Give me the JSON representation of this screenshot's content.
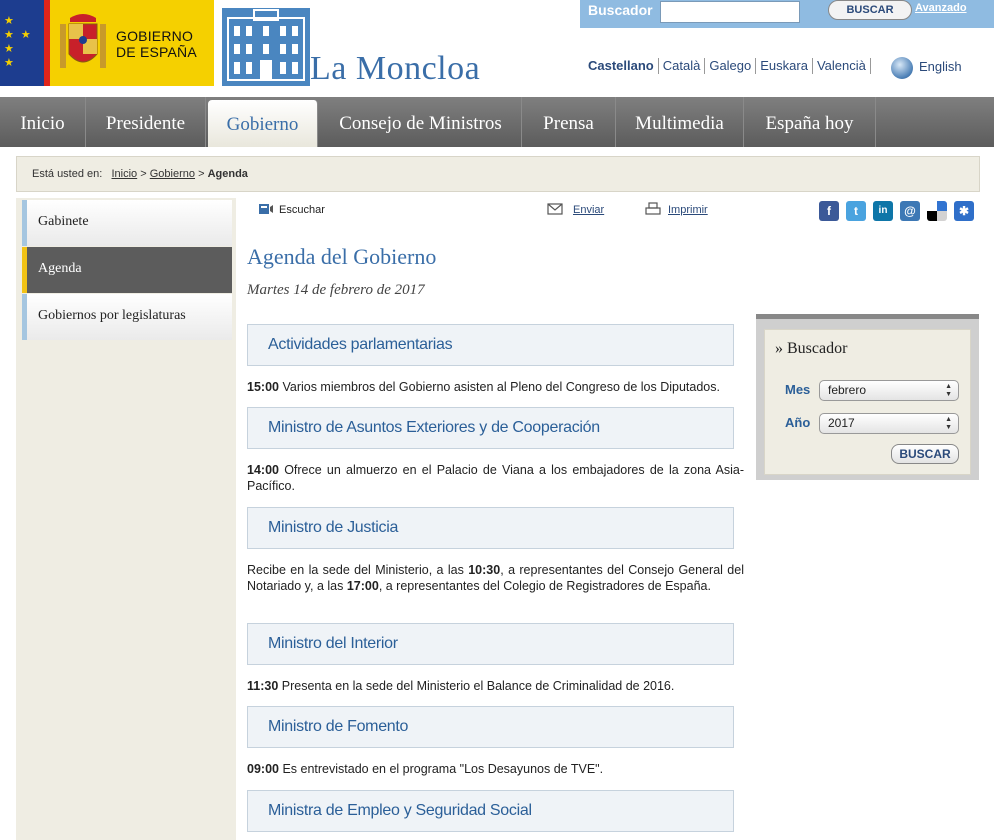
{
  "header": {
    "gov_title_line1": "GOBIERNO",
    "gov_title_line2": "DE ESPAÑA",
    "site_title": "La Moncloa",
    "search_label": "Buscador",
    "search_value": "",
    "search_button": "BUSCAR",
    "advanced_link": "Avanzado",
    "languages": [
      "Castellano",
      "Català",
      "Galego",
      "Euskara",
      "Valencià"
    ],
    "selected_language": "Castellano",
    "english": "English"
  },
  "nav": {
    "items": [
      "Inicio",
      "Presidente",
      "Gobierno",
      "Consejo de Ministros",
      "Prensa",
      "Multimedia",
      "España hoy"
    ],
    "active": "Gobierno"
  },
  "breadcrumb": {
    "prefix": "Está usted en:",
    "items": [
      "Inicio",
      "Gobierno"
    ],
    "current": "Agenda",
    "sep": ">"
  },
  "sidebar": {
    "items": [
      {
        "label": "Gabinete"
      },
      {
        "label": "Agenda"
      },
      {
        "label": "Gobiernos por legislaturas"
      }
    ],
    "active": "Agenda"
  },
  "tools": {
    "listen": "Escuchar",
    "send": "Enviar",
    "print": "Imprimir"
  },
  "main": {
    "title": "Agenda del Gobierno",
    "date": "Martes 14 de febrero de 2017",
    "sections": [
      {
        "title": "Actividades parlamentarias"
      },
      {
        "title": "Ministro de Asuntos Exteriores y de Cooperación"
      },
      {
        "title": "Ministro de Justicia"
      },
      {
        "title": "Ministro del Interior"
      },
      {
        "title": "Ministro de Fomento"
      },
      {
        "title": "Ministra de Empleo y Seguridad Social"
      }
    ],
    "entries": {
      "e1_time": "15:00",
      "e1_text": " Varios miembros del Gobierno asisten al Pleno del Congreso de los Diputados.",
      "e2_time": "14:00",
      "e2_text": "  Ofrece un almuerzo en el Palacio de Viana a los embajadores de la zona Asia-Pacífico.",
      "e3_a": "Recibe en la sede del Ministerio, a las ",
      "e3_t1": "10:30",
      "e3_b": ", a representantes del Consejo General del Notariado y, a las ",
      "e3_t2": "17:00",
      "e3_c": ", a representantes del Colegio de Registradores de España.",
      "e4_time": "11:30",
      "e4_text": " Presenta en la sede del Ministerio el Balance de Criminalidad de 2016.",
      "e5_time": "09:00",
      "e5_text": " Es entrevistado en el programa \"Los Desayunos de TVE\"."
    }
  },
  "right_search": {
    "title": "» Buscador",
    "month_label": "Mes",
    "month_value": "febrero",
    "year_label": "Año",
    "year_value": "2017",
    "button": "BUSCAR"
  },
  "colors": {
    "brand_blue": "#3a6ea8",
    "nav_gray": "#5c5c5c",
    "gov_yellow": "#f5d000",
    "flag_red": "#e0251b"
  }
}
